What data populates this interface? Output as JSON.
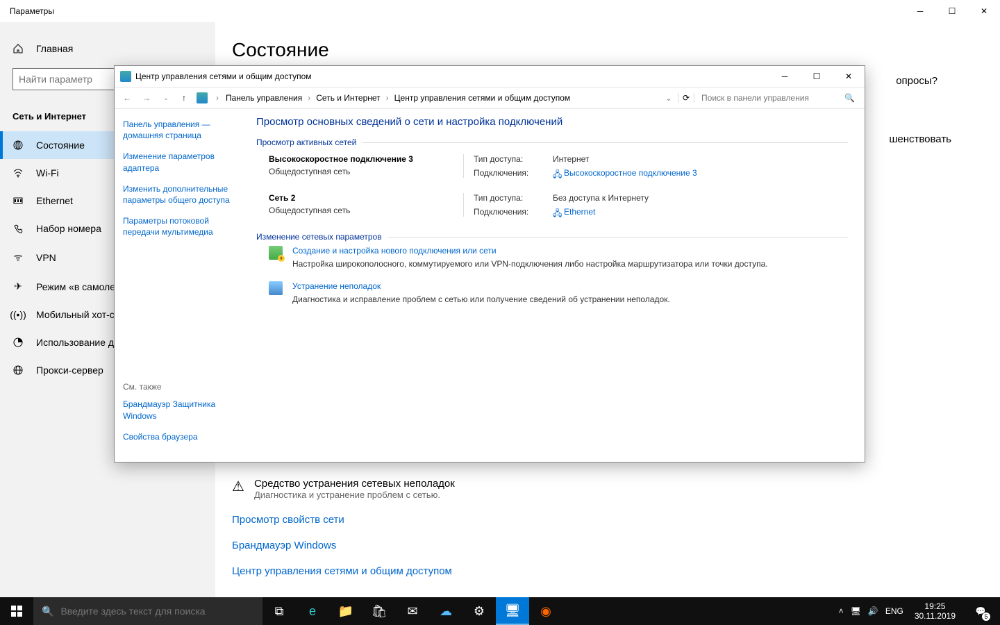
{
  "settings": {
    "window_title": "Параметры",
    "home": "Главная",
    "search_placeholder": "Найти параметр",
    "group_title": "Сеть и Интернет",
    "page_title": "Состояние",
    "right_fragment": "опросы?",
    "right_fragment2": "шенствовать",
    "sidebar": [
      {
        "label": "Состояние",
        "icon": "status-icon"
      },
      {
        "label": "Wi-Fi",
        "icon": "wifi-icon"
      },
      {
        "label": "Ethernet",
        "icon": "ethernet-icon"
      },
      {
        "label": "Набор номера",
        "icon": "dialup-icon"
      },
      {
        "label": "VPN",
        "icon": "vpn-icon"
      },
      {
        "label": "Режим «в самолете»",
        "icon": "airplane-icon"
      },
      {
        "label": "Мобильный хот-спот",
        "icon": "hotspot-icon"
      },
      {
        "label": "Использование данных",
        "icon": "data-usage-icon"
      },
      {
        "label": "Прокси-сервер",
        "icon": "proxy-icon"
      }
    ],
    "troubleshooter": {
      "title": "Средство устранения сетевых неполадок",
      "desc": "Диагностика и устранение проблем с сетью."
    },
    "links": [
      "Просмотр свойств сети",
      "Брандмауэр Windows",
      "Центр управления сетями и общим доступом"
    ]
  },
  "cp": {
    "title": "Центр управления сетями и общим доступом",
    "breadcrumbs": [
      "Панель управления",
      "Сеть и Интернет",
      "Центр управления сетями и общим доступом"
    ],
    "search_placeholder": "Поиск в панели управления",
    "left_links": [
      "Панель управления — домашняя страница",
      "Изменение параметров адаптера",
      "Изменить дополнительные параметры общего доступа",
      "Параметры потоковой передачи мультимедиа"
    ],
    "see_also_title": "См. также",
    "see_also": [
      "Брандмауэр Защитника Windows",
      "Свойства браузера"
    ],
    "heading": "Просмотр основных сведений о сети и настройка подключений",
    "active_nets_label": "Просмотр активных сетей",
    "nets": [
      {
        "name": "Высокоскоростное подключение 3",
        "type": "Общедоступная сеть",
        "access_label": "Тип доступа:",
        "access_value": "Интернет",
        "conn_label": "Подключения:",
        "conn_link": "Высокоскоростное подключение 3"
      },
      {
        "name": "Сеть 2",
        "type": "Общедоступная сеть",
        "access_label": "Тип доступа:",
        "access_value": "Без доступа к Интернету",
        "conn_label": "Подключения:",
        "conn_link": "Ethernet"
      }
    ],
    "change_label": "Изменение сетевых параметров",
    "tasks": [
      {
        "title": "Создание и настройка нового подключения или сети",
        "desc": "Настройка широкополосного, коммутируемого или VPN-подключения либо настройка маршрутизатора или точки доступа."
      },
      {
        "title": "Устранение неполадок",
        "desc": "Диагностика и исправление проблем с сетью или получение сведений об устранении неполадок."
      }
    ]
  },
  "taskbar": {
    "search_placeholder": "Введите здесь текст для поиска",
    "lang": "ENG",
    "time": "19:25",
    "date": "30.11.2019",
    "notif_count": "5"
  }
}
